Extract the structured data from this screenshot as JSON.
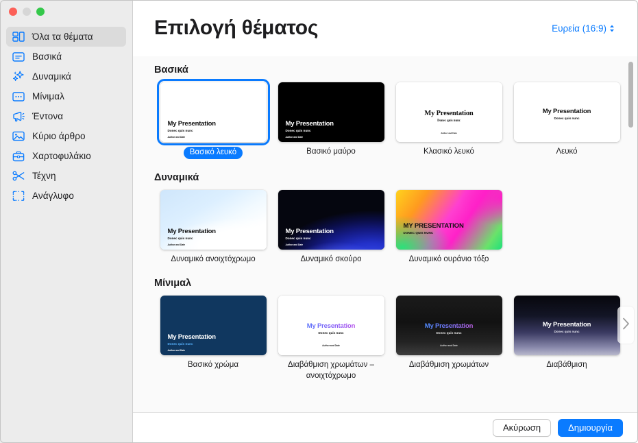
{
  "window": {
    "traffic_lights": [
      "close",
      "minimize",
      "zoom"
    ]
  },
  "sidebar": {
    "items": [
      {
        "label": "Όλα τα θέματα",
        "icon": "all-themes-icon",
        "selected": true
      },
      {
        "label": "Βασικά",
        "icon": "basic-icon",
        "selected": false
      },
      {
        "label": "Δυναμικά",
        "icon": "sparkles-icon",
        "selected": false
      },
      {
        "label": "Μίνιμαλ",
        "icon": "minimal-icon",
        "selected": false
      },
      {
        "label": "Έντονα",
        "icon": "megaphone-icon",
        "selected": false
      },
      {
        "label": "Κύριο άρθρο",
        "icon": "photo-icon",
        "selected": false
      },
      {
        "label": "Χαρτοφυλάκιο",
        "icon": "briefcase-icon",
        "selected": false
      },
      {
        "label": "Τέχνη",
        "icon": "scissors-icon",
        "selected": false
      },
      {
        "label": "Ανάγλυφο",
        "icon": "crop-icon",
        "selected": false
      }
    ]
  },
  "header": {
    "title": "Επιλογή θέματος",
    "aspect_ratio_label": "Ευρεία (16:9)",
    "aspect_ratio_icon": "chevron-up-down-icon"
  },
  "slide_text": {
    "title": "My Presentation",
    "title_caps": "MY PRESENTATION",
    "subtitle": "Donec quis nunc",
    "author": "Author and Date"
  },
  "sections": [
    {
      "title": "Βασικά",
      "themes": [
        {
          "name": "Βασικό λευκό",
          "selected": true,
          "style": "basic-white"
        },
        {
          "name": "Βασικό μαύρο",
          "selected": false,
          "style": "basic-black"
        },
        {
          "name": "Κλασικό λευκό",
          "selected": false,
          "style": "classic-white"
        },
        {
          "name": "Λευκό",
          "selected": false,
          "style": "white"
        }
      ]
    },
    {
      "title": "Δυναμικά",
      "themes": [
        {
          "name": "Δυναμικό ανοιχτόχρωμο",
          "selected": false,
          "style": "dynamic-light"
        },
        {
          "name": "Δυναμικό σκούρο",
          "selected": false,
          "style": "dynamic-dark"
        },
        {
          "name": "Δυναμικό ουράνιο τόξο",
          "selected": false,
          "style": "dynamic-rainbow"
        }
      ]
    },
    {
      "title": "Μίνιμαλ",
      "themes": [
        {
          "name": "Βασικό χρώμα",
          "selected": false,
          "style": "color-basic"
        },
        {
          "name": "Διαβάθμιση χρωμάτων – ανοιχτόχρωμο",
          "selected": false,
          "style": "gradient-light"
        },
        {
          "name": "Διαβάθμιση χρωμάτων",
          "selected": false,
          "style": "gradient-dark"
        },
        {
          "name": "Διαβάθμιση",
          "selected": false,
          "style": "gradient"
        }
      ]
    }
  ],
  "next_arrow_icon": "chevron-right-icon",
  "footer": {
    "cancel_label": "Ακύρωση",
    "create_label": "Δημιουργία"
  },
  "colors": {
    "accent": "#0a7bff",
    "sidebar_bg": "#ececec",
    "selected_row": "#dbdbdb",
    "content_bg": "#fafafa"
  }
}
